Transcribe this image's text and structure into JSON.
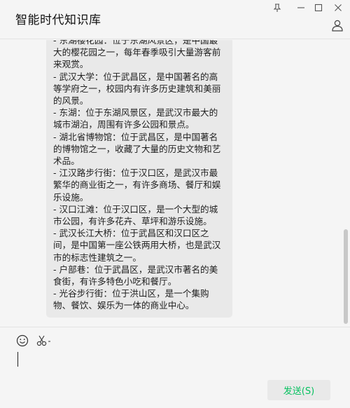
{
  "window": {
    "title": "智能时代知识库",
    "controls": [
      "pin-icon",
      "minimize-icon",
      "maximize-icon",
      "close-icon"
    ],
    "profile_icon": "user-icon"
  },
  "chat": {
    "message_lines": [
      "- 东湖樱花园：位于东湖风景区，是中国最",
      "大的樱花园之一，每年春季吸引大量游客前",
      "来观赏。",
      "- 武汉大学：位于武昌区，是中国著名的高",
      "等学府之一，校园内有许多历史建筑和美丽",
      "的风景。",
      "- 东湖：位于东湖风景区，是武汉市最大的",
      "城市湖泊，周围有许多公园和景点。",
      "- 湖北省博物馆：位于武昌区，是中国著名",
      "的博物馆之一，收藏了大量的历史文物和艺",
      "术品。",
      "- 江汉路步行街：位于汉口区，是武汉市最",
      "繁华的商业街之一，有许多商场、餐厅和娱",
      "乐设施。",
      "- 汉口江滩：位于汉口区，是一个大型的城",
      "市公园，有许多花卉、草坪和游乐设施。",
      "- 武汉长江大桥：位于武昌区和汉口区之",
      "间，是中国第一座公铁两用大桥，也是武汉",
      "市的标志性建筑之一。",
      "- 户部巷：位于武昌区，是武汉市著名的美",
      "食街，有许多特色小吃和餐厅。",
      "- 光谷步行街：位于洪山区，是一个集购",
      "物、餐饮、娱乐为一体的商业中心。"
    ]
  },
  "toolbar": {
    "emoji_icon": "emoji-icon",
    "screenshot_icon": "scissors-icon"
  },
  "input": {
    "value": ""
  },
  "send_button": {
    "label": "发送(S)"
  },
  "colors": {
    "accent": "#07c160",
    "bubble": "#e9e9e9",
    "background": "#f5f5f5"
  }
}
